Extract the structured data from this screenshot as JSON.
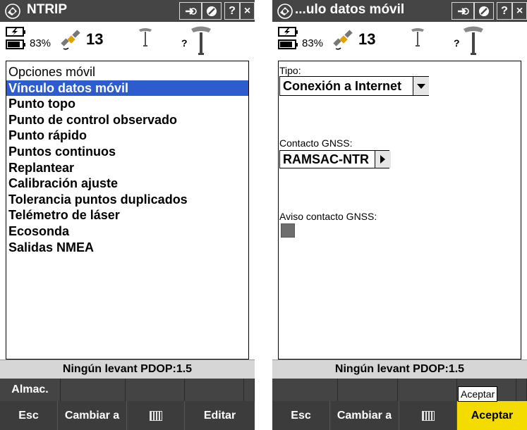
{
  "screen1": {
    "title": "NTRIP",
    "title_buttons": {
      "left": "⇨",
      "help": "?",
      "close": "×"
    },
    "status": {
      "battery_percent": "83%",
      "satellites": "13",
      "unknown_marker": "?"
    },
    "menu_items": [
      "Opciones móvil",
      "Vínculo datos móvil",
      "Punto topo",
      "Punto de control observado",
      "Punto rápido",
      "Puntos continuos",
      "Replantear",
      "Calibración ajuste",
      "Tolerancia puntos duplicados",
      "Telémetro de láser",
      "Ecosonda",
      "Salidas NMEA"
    ],
    "selected_index": 1,
    "status_line": "Ningún levant  PDOP:1.5",
    "softkeys": [
      "Almac.",
      "",
      "",
      "",
      ""
    ],
    "bottom_buttons": {
      "esc": "Esc",
      "change": "Cambiar a",
      "edit": "Editar"
    }
  },
  "screen2": {
    "title": "...ulo datos móvil",
    "title_buttons": {
      "left": "⇨",
      "help": "?",
      "close": "×"
    },
    "status": {
      "battery_percent": "83%",
      "satellites": "13",
      "unknown_marker": "?"
    },
    "type_label": "Tipo:",
    "type_value": "Conexión a Internet",
    "contact_label": "Contacto GNSS:",
    "contact_value": "RAMSAC-NTR",
    "notice_label": "Aviso contacto GNSS:",
    "notice_checked": false,
    "status_line": "Ningún levant  PDOP:1.5",
    "tooltip": "Aceptar",
    "bottom_buttons": {
      "esc": "Esc",
      "change": "Cambiar a",
      "accept": "Aceptar"
    }
  },
  "colors": {
    "titlebar": "#454545",
    "selection": "#2d5ccf",
    "accent_button": "#f5dc00"
  }
}
